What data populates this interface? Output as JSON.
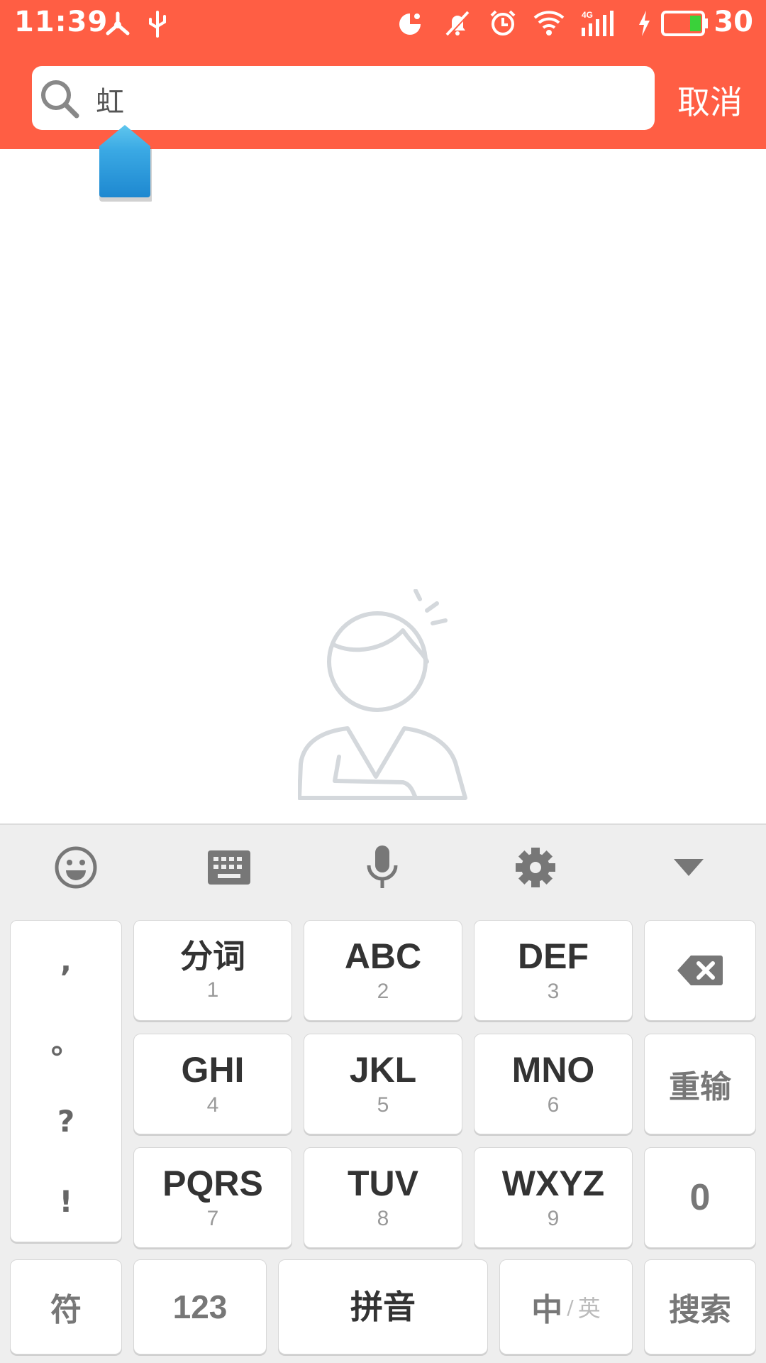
{
  "status_bar": {
    "time": "11:39",
    "battery_level": "30",
    "icons": [
      "share-icon",
      "usb-icon",
      "data-saver-icon",
      "mute-icon",
      "alarm-icon",
      "wifi-icon",
      "signal-4g-icon",
      "charging-icon",
      "battery-icon"
    ]
  },
  "search": {
    "value": "虹",
    "cancel_label": "取消"
  },
  "colors": {
    "header": "#FF5E44",
    "cursor_handle": "#1E88D0",
    "keyboard_bg": "#EEEEEE"
  },
  "keyboard": {
    "toolbar": [
      "emoji-icon",
      "keyboard-icon",
      "microphone-icon",
      "settings-icon",
      "collapse-icon"
    ],
    "punctuation": [
      ",",
      "。",
      "?",
      "!"
    ],
    "keys": [
      {
        "main": "分词",
        "sub": "1"
      },
      {
        "main": "ABC",
        "sub": "2"
      },
      {
        "main": "DEF",
        "sub": "3"
      },
      {
        "main": "GHI",
        "sub": "4"
      },
      {
        "main": "JKL",
        "sub": "5"
      },
      {
        "main": "MNO",
        "sub": "6"
      },
      {
        "main": "PQRS",
        "sub": "7"
      },
      {
        "main": "TUV",
        "sub": "8"
      },
      {
        "main": "WXYZ",
        "sub": "9"
      }
    ],
    "reset_label": "重输",
    "zero_label": "0",
    "symbol_label": "符",
    "numeric_label": "123",
    "space_label": "拼音",
    "lang_primary": "中",
    "lang_separator": "/",
    "lang_secondary": "英",
    "search_label": "搜索"
  }
}
